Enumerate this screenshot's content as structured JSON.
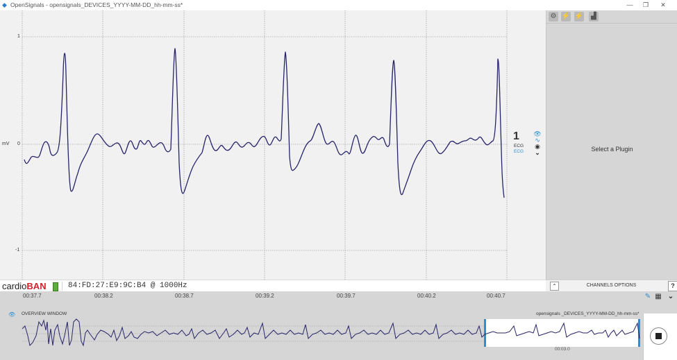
{
  "window": {
    "title": "OpenSignals - opensignals_DEVICES_YYYY-MM-DD_hh-mm-ss*",
    "minimize": "—",
    "restore": "❐",
    "close": "✕"
  },
  "plot": {
    "unit_label": "mV",
    "y_ticks": [
      "1",
      "0",
      "-1"
    ],
    "channel_number": "1",
    "channel_type": "ECG",
    "channel_label": "ECG",
    "icons": [
      "eye-icon",
      "wave-icon",
      "record-icon",
      "chevron-down-icon"
    ]
  },
  "device": {
    "brand_prefix": "cardio",
    "brand_suffix": "BAN",
    "id_text": "84:FD:27:E9:9C:B4 @ 1000Hz"
  },
  "right_panel": {
    "placeholder": "Select a Plugin",
    "plugin_buttons": [
      "settings-icon",
      "plug-icon",
      "plug-off-icon",
      "chart-icon"
    ]
  },
  "channels_options": {
    "label": "CHANNELS OPTIONS",
    "help": "?"
  },
  "time_axis": {
    "ticks": [
      "00:37.7",
      "00:38.2",
      "00:38.7",
      "00:39.2",
      "00:39.7",
      "00:40.2",
      "00:40.7"
    ]
  },
  "overview": {
    "label": "OVERVIEW WINDOW",
    "file_name": "opensignals _DEVICES_YYYY-MM-DD_hh-mm-ss*",
    "time_label": "00:03.0"
  },
  "colors": {
    "signal": "#26236b",
    "accent": "#2a8fd4",
    "brand_red": "#d91f2d"
  }
}
